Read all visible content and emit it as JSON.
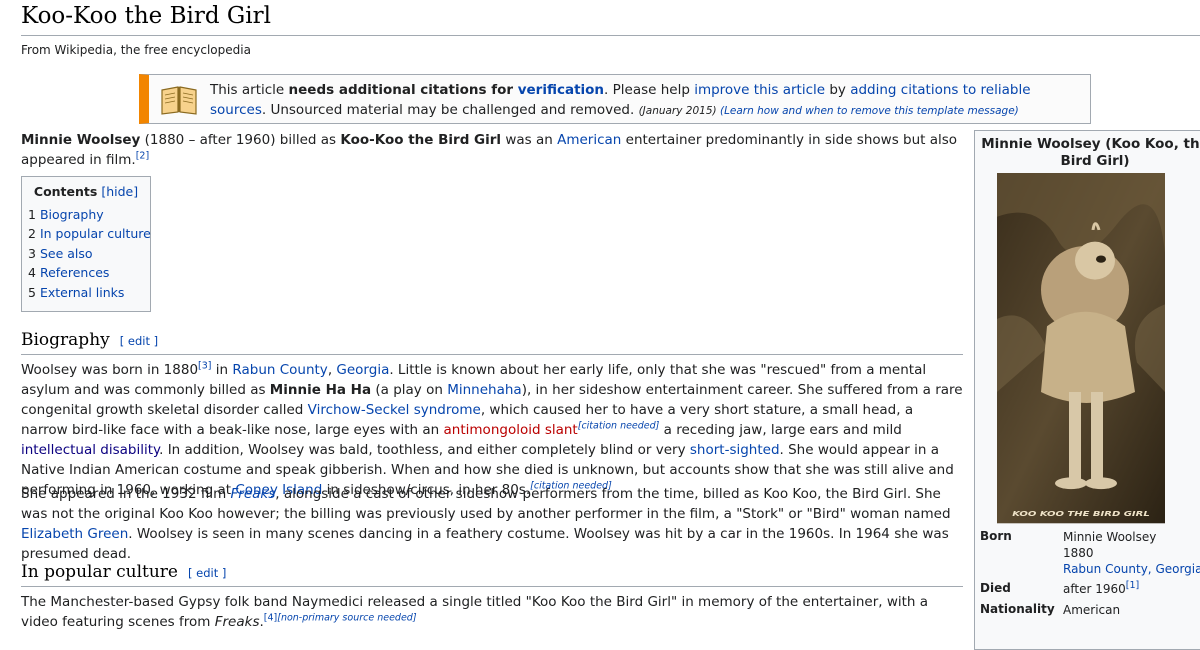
{
  "page": {
    "title": "Koo-Koo the Bird Girl",
    "tagline": "From Wikipedia, the free encyclopedia"
  },
  "ambox": {
    "icon": "book-icon",
    "text_1": "This article ",
    "text_bold": "needs additional citations for ",
    "verification_link": "verification",
    "text_2": ". Please help ",
    "improve_link": "improve this article",
    "text_3": " by ",
    "adding_link": "adding citations to reliable sources",
    "text_4": ". Unsourced material may be challenged and removed. ",
    "date": "(January 2015)",
    "learn_link": "(Learn how and when to remove this template message)"
  },
  "intro": {
    "subject": "Minnie Woolsey",
    "t1": " (1880 – after 1960) billed as ",
    "bold_name": "Koo-Koo the Bird Girl",
    "t2": " was an ",
    "american_link": "American",
    "t3": " entertainer predominantly in side shows but also appeared in film.",
    "ref2": "[2]"
  },
  "toc": {
    "title": "Contents",
    "hide_link": "[hide]",
    "items": [
      {
        "num": "1",
        "label": "Biography"
      },
      {
        "num": "2",
        "label": "In popular culture"
      },
      {
        "num": "3",
        "label": "See also"
      },
      {
        "num": "4",
        "label": "References"
      },
      {
        "num": "5",
        "label": "External links"
      }
    ]
  },
  "sections": {
    "biography": {
      "heading": "Biography",
      "edit": "[ edit ]"
    },
    "popular": {
      "heading": "In popular culture",
      "edit": "[ edit ]"
    }
  },
  "bio_p1": {
    "t1": "Woolsey was born in 1880",
    "ref3": "[3]",
    "t2": " in ",
    "rabun_link": "Rabun County",
    "t3": ", ",
    "georgia_link": "Georgia",
    "t4": ". Little is known about her early life, only that she was \"rescued\" from a mental asylum and was commonly billed as ",
    "bold_minnie": "Minnie Ha Ha",
    "t5": " (a play on ",
    "minnehaha_link": "Minnehaha",
    "t6": "), in her sideshow entertainment career. She suffered from a rare congenital growth skeletal disorder called ",
    "virchow_link": "Virchow-Seckel syndrome",
    "t7": ", which caused her to have a very short stature, a small head, a narrow bird-like face with a beak-like nose, large eyes with an ",
    "antimongoloid_link": "antimongoloid slant",
    "cn1": "[citation needed]",
    "t8": " a receding jaw, large ears and mild ",
    "intellectual_link": "intellectual disability",
    "t9": ". In addition, Woolsey was bald, toothless, and either completely blind or very ",
    "shortsighted_link": "short-sighted",
    "t10": ". She would appear in a Native Indian American costume and speak gibberish. When and how she died is unknown, but accounts show that she was still alive and performing in 1960, working at ",
    "coney_link": "Coney Island",
    "t11": " in sideshow/circus, in her 80s.",
    "cn2": "[citation needed]"
  },
  "bio_p2": {
    "t1": "She appeared in the 1932 film ",
    "freaks_link": "Freaks",
    "t2": ", alongside a cast of other sideshow performers from the time, billed as Koo Koo, the Bird Girl. She was not the original Koo Koo however; the billing was previously used by another performer in the film, a \"Stork\" or \"Bird\" woman named ",
    "green_link": "Elizabeth Green",
    "t3": ". Woolsey is seen in many scenes dancing in a feathery costume. Woolsey was hit by a car in the 1960s. In 1964 she was presumed dead."
  },
  "pop_p1": {
    "t1": "The Manchester-based Gypsy folk band Naymedici released a single titled \"Koo Koo the Bird Girl\" in memory of the entertainer, with a video featuring scenes from ",
    "freaks": "Freaks",
    "t2": ".",
    "ref4": "[4]",
    "nps": "[non-primary source needed]"
  },
  "infobox": {
    "title": "Minnie Woolsey (Koo Koo, the Bird Girl)",
    "image_caption": "KOO KOO THE BIRD GIRL",
    "born_label": "Born",
    "born_name": "Minnie Woolsey",
    "born_year": "1880",
    "born_place": "Rabun County, Georgia",
    "died_label": "Died",
    "died_value": "after 1960",
    "died_ref": "[1]",
    "nationality_label": "Nationality",
    "nationality_value": "American"
  }
}
